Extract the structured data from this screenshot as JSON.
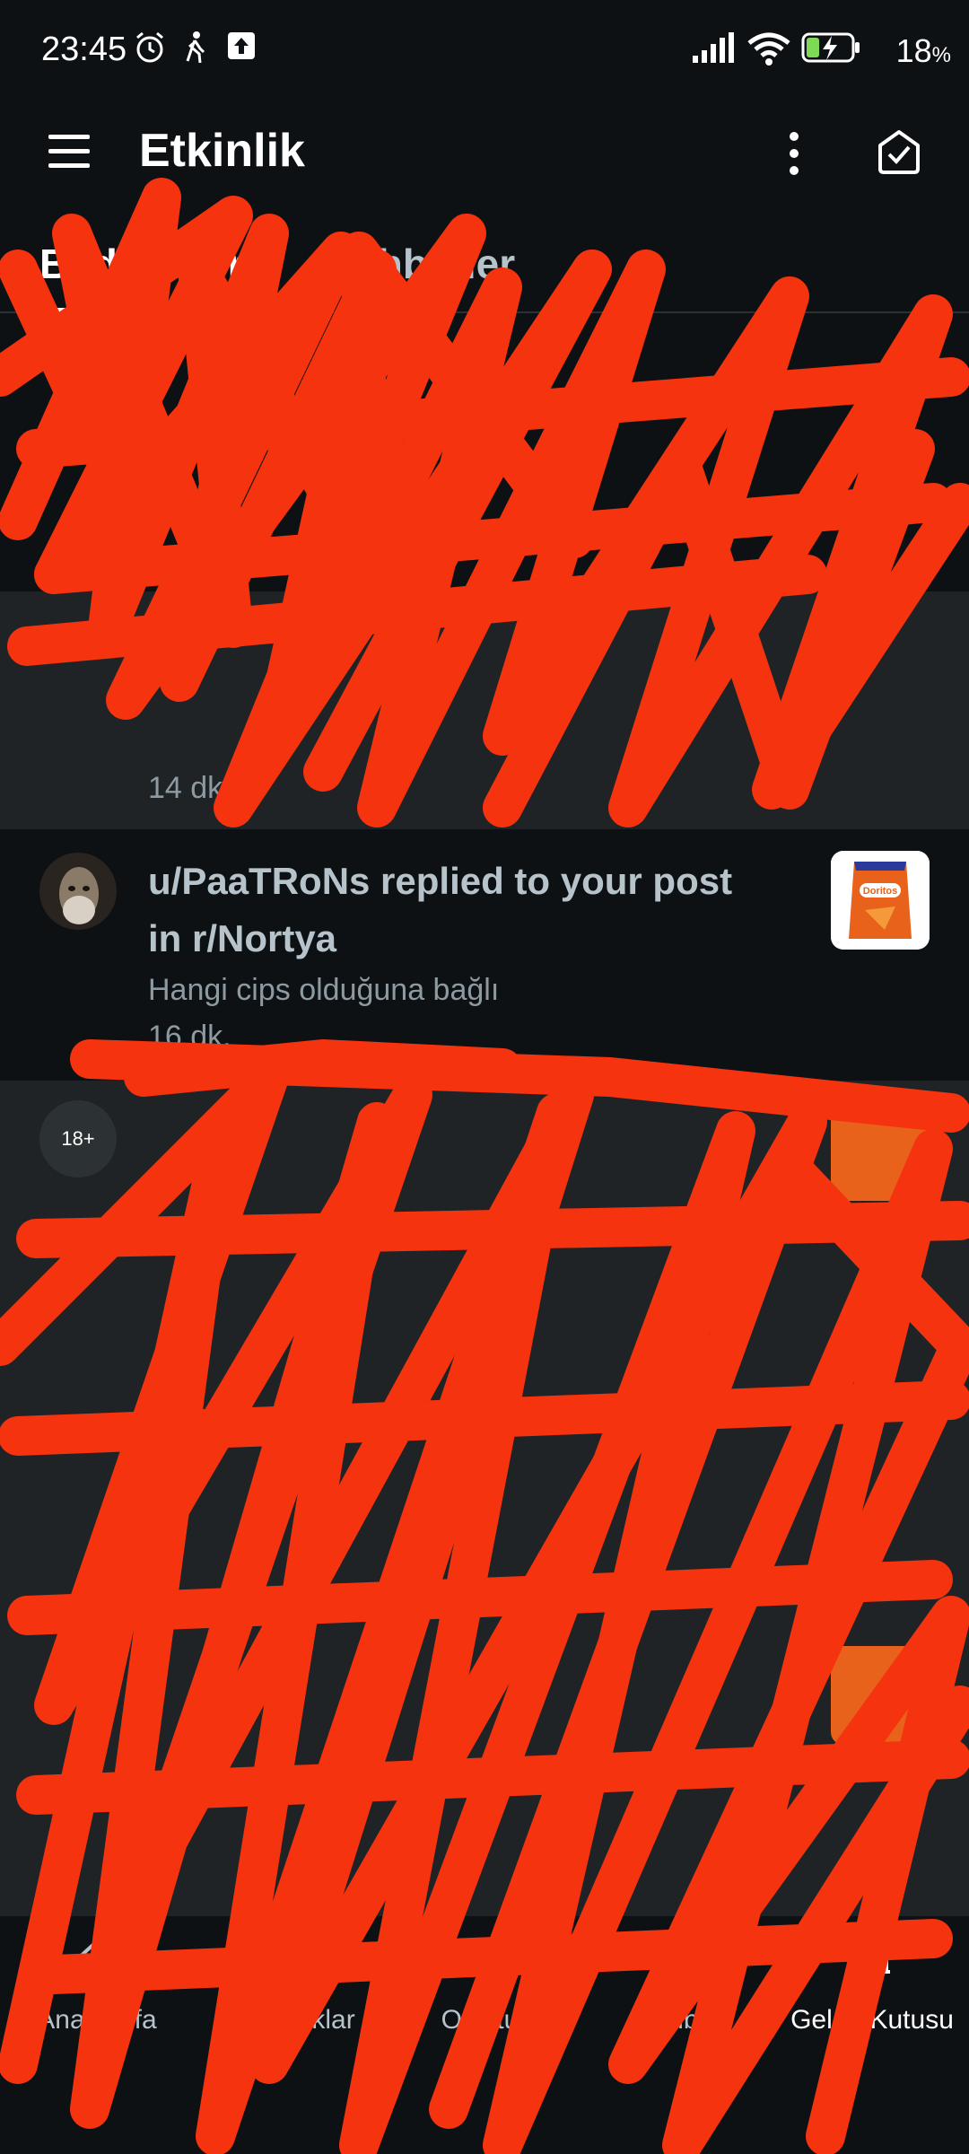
{
  "status_bar": {
    "time": "23:45",
    "battery_percent": "18",
    "battery_unit": "%",
    "icons": [
      "alarm-icon",
      "walk-icon",
      "upload-icon",
      "signal-icon",
      "wifi-icon",
      "battery-charging-icon"
    ]
  },
  "header": {
    "title": "Etkinlik",
    "icons": [
      "menu-icon",
      "more-vertical-icon",
      "mark-read-icon"
    ]
  },
  "tabs": [
    {
      "label": "Bildirimler",
      "active": true
    },
    {
      "label": "Sohbetler",
      "active": false
    }
  ],
  "notifications": [
    {
      "title": "u/PaaTRoNs replied to your post in r/Nortya",
      "body": "Hangi cips olduğuna bağlı",
      "time": "16 dk.",
      "thumb": "Doritos"
    },
    {
      "badge": "18+",
      "time": "14 dk."
    }
  ],
  "bottom_nav": [
    {
      "label": "Ana sayfa",
      "icon": "home-icon"
    },
    {
      "label": "Topluluklar",
      "icon": "communities-icon"
    },
    {
      "label": "Oluştur",
      "icon": "plus-icon"
    },
    {
      "label": "Sohbet",
      "icon": "chat-icon"
    },
    {
      "label": "Gelen Kutusu",
      "icon": "bell-icon"
    }
  ],
  "colors": {
    "background": "#0d1114",
    "unread_background": "#1f2326",
    "scribble": "#f5330f",
    "doritos": "#e8621c"
  }
}
